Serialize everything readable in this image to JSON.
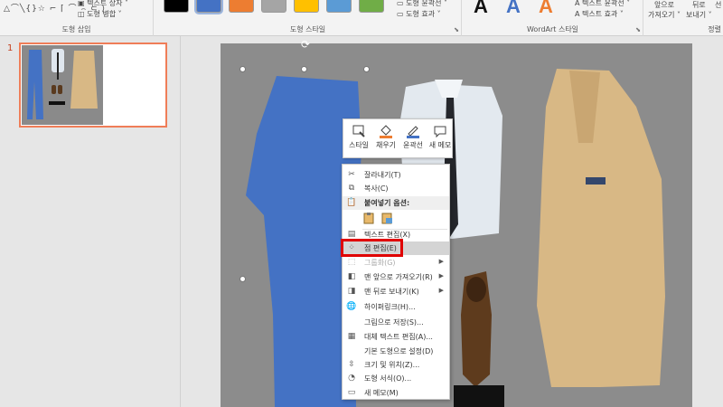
{
  "ribbon": {
    "groups": {
      "insert_shapes": "도형 삽입",
      "shape_styles": "도형 스타일",
      "wordart_styles": "WordArt 스타일",
      "arrange": "정렬"
    },
    "textbox_label": "텍스트 상자 ˅",
    "merge_shapes_label": "도형 병합 ˅",
    "shape_outline_label": "도형 윤곽선 ˅",
    "shape_effects_label": "도형 효과 ˅",
    "text_outline_label": "텍스트 윤곽선 ˅",
    "text_effects_label": "텍스트 효과 ˅",
    "bring_forward_line1": "앞으로",
    "bring_forward_line2": "가져오기 ˅",
    "send_backward_line1": "뒤로",
    "send_backward_line2": "보내기 ˅",
    "selection_pane_partial": "선",
    "wordart_letter": "A",
    "style_swatch_colors": [
      "#000000",
      "#4472c4",
      "#ed7d31",
      "#a5a5a5",
      "#ffc000",
      "#5b9bd5",
      "#70ad47"
    ]
  },
  "thumbnails": {
    "slide_number": "1"
  },
  "mini_toolbar": {
    "style": "스타일",
    "fill": "채우기",
    "outline": "윤곽선",
    "new_comment": "새 메모"
  },
  "context_menu": {
    "cut": "잘라내기(T)",
    "copy": "복사(C)",
    "paste_options": "붙여넣기 옵션:",
    "edit_text": "텍스트 편집(X)",
    "edit_points": "점 편집(E)",
    "group": "그룹화(G)",
    "bring_to_front": "맨 앞으로 가져오기(R)",
    "send_to_back": "맨 뒤로 보내기(K)",
    "hyperlink": "하이퍼링크(H)...",
    "save_as_picture": "그림으로 저장(S)...",
    "edit_alt_text": "대체 텍스트 편집(A)...",
    "set_default_shape": "기본 도형으로 설정(D)",
    "size_and_position": "크기 및 위치(Z)...",
    "format_shape": "도형 서식(O)...",
    "new_comment": "새 메모(M)"
  },
  "colors": {
    "selected_shape": "#4472c4",
    "highlight_box": "#e00000",
    "thumbnail_border": "#ef7d58"
  }
}
